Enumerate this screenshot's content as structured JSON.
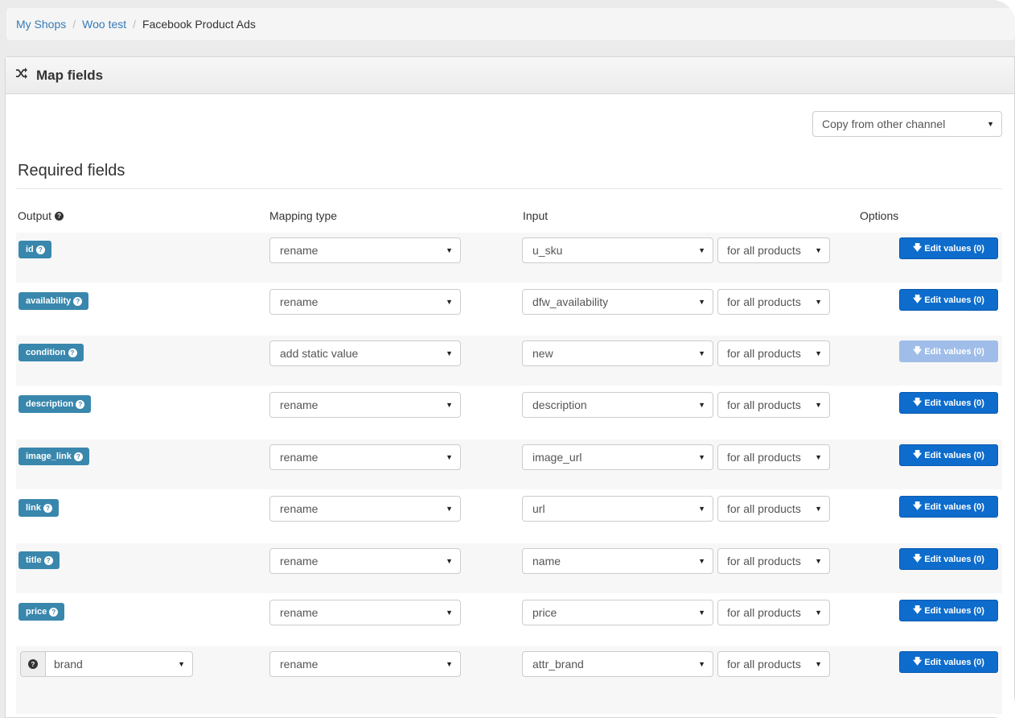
{
  "breadcrumb": {
    "items": [
      "My Shops",
      "Woo test"
    ],
    "active": "Facebook Product Ads"
  },
  "panel": {
    "title": "Map fields",
    "icon": "shuffle-icon"
  },
  "copy_select": {
    "value": "Copy from other channel"
  },
  "section": {
    "title": "Required fields"
  },
  "columns": {
    "output": "Output",
    "mapping_type": "Mapping type",
    "input": "Input",
    "options": "Options"
  },
  "rows": [
    {
      "output": "id",
      "mapping": "rename",
      "input": "u_sku",
      "scope": "for all products",
      "button": "Edit values (0)"
    },
    {
      "output": "availability",
      "mapping": "rename",
      "input": "dfw_availability",
      "scope": "for all products",
      "button": "Edit values (0)"
    },
    {
      "output": "condition",
      "mapping": "add static value",
      "input": "new",
      "scope": "for all products",
      "button": "Edit values (0)"
    },
    {
      "output": "description",
      "mapping": "rename",
      "input": "description",
      "scope": "for all products",
      "button": "Edit values (0)"
    },
    {
      "output": "image_link",
      "mapping": "rename",
      "input": "image_url",
      "scope": "for all products",
      "button": "Edit values (0)"
    },
    {
      "output": "link",
      "mapping": "rename",
      "input": "url",
      "scope": "for all products",
      "button": "Edit values (0)"
    },
    {
      "output": "title",
      "mapping": "rename",
      "input": "name",
      "scope": "for all products",
      "button": "Edit values (0)"
    },
    {
      "output": "price",
      "mapping": "rename",
      "input": "price",
      "scope": "for all products",
      "button": "Edit values (0)"
    },
    {
      "output": "brand",
      "mapping": "rename",
      "input": "attr_brand",
      "scope": "for all products",
      "button": "Edit values (0)"
    }
  ],
  "colors": {
    "label_bg": "#3a87ad",
    "button_bg": "#0d6ccc",
    "button_disabled_bg": "#9fbde8",
    "link": "#337ab7"
  }
}
